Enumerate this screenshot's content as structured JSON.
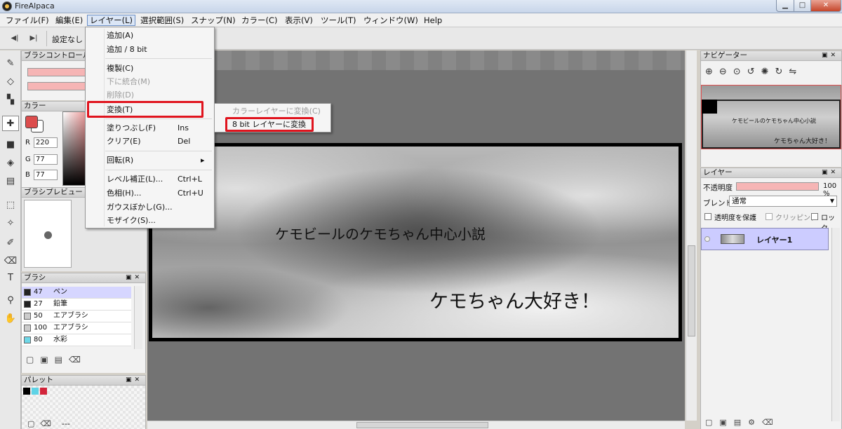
{
  "window": {
    "title": "FireAlpaca",
    "minimize": "▁",
    "maximize": "□",
    "close": "✕"
  },
  "menubar": [
    "ファイル(F)",
    "編集(E)",
    "レイヤー(L)",
    "選択範囲(S)",
    "スナップ(N)",
    "カラー(C)",
    "表示(V)",
    "ツール(T)",
    "ウィンドウ(W)",
    "Help"
  ],
  "toolbar": {
    "prev": "◀|",
    "next": "▶|",
    "preset_label": "設定なし"
  },
  "layer_menu": {
    "items": [
      {
        "label": "追加(A)",
        "shortcut": "",
        "disabled": false
      },
      {
        "label": "追加 / 8 bit",
        "shortcut": "",
        "disabled": false
      },
      {
        "label": "複製(C)",
        "shortcut": "",
        "disabled": false
      },
      {
        "label": "下に統合(M)",
        "shortcut": "",
        "disabled": true
      },
      {
        "label": "削除(D)",
        "shortcut": "",
        "disabled": true
      },
      {
        "label": "変換(T)",
        "shortcut": "",
        "disabled": false
      },
      {
        "label": "塗りつぶし(F)",
        "shortcut": "Ins",
        "disabled": false
      },
      {
        "label": "クリア(E)",
        "shortcut": "Del",
        "disabled": false
      },
      {
        "label": "回転(R)",
        "shortcut": "▸",
        "disabled": false
      },
      {
        "label": "レベル補正(L)...",
        "shortcut": "Ctrl+L",
        "disabled": false
      },
      {
        "label": "色相(H)...",
        "shortcut": "Ctrl+U",
        "disabled": false
      },
      {
        "label": "ガウスぼかし(G)...",
        "shortcut": "",
        "disabled": false
      },
      {
        "label": "モザイク(S)...",
        "shortcut": "",
        "disabled": false
      }
    ]
  },
  "convert_submenu": {
    "items": [
      {
        "label": "カラーレイヤーに変換(C)",
        "disabled": true
      },
      {
        "label": "8 bit レイヤーに変換",
        "disabled": false
      }
    ]
  },
  "panels": {
    "brush_control": {
      "title": "ブラシコントロール",
      "size_fraction": 0.55
    },
    "color": {
      "title": "カラー",
      "r_label": "R",
      "r": "220",
      "g_label": "G",
      "g": "77",
      "b_label": "B",
      "b": "77",
      "fg": "#dc4d4d",
      "bg": "#ffffff"
    },
    "brush_preview": {
      "title": "ブラシプレビュー"
    },
    "brush": {
      "title": "ブラシ",
      "items": [
        {
          "size": "47",
          "name": "ペン",
          "selected": true,
          "swatch": "#222222"
        },
        {
          "size": "27",
          "name": "鉛筆",
          "selected": false,
          "swatch": "#222222"
        },
        {
          "size": "50",
          "name": "エアブラシ",
          "selected": false,
          "swatch": "#cccccc"
        },
        {
          "size": "100",
          "name": "エアブラシ",
          "selected": false,
          "swatch": "#cccccc"
        },
        {
          "size": "80",
          "name": "水彩",
          "selected": false,
          "swatch": "#6fd8e8"
        }
      ]
    },
    "palette": {
      "title": "パレット",
      "footer": "---",
      "swatches": [
        "#000000",
        "#5fd3e6",
        "#d2243a"
      ]
    },
    "navigator": {
      "title": "ナビゲーター",
      "thumb_text1": "ケモビールのケモちゃん中心小説",
      "thumb_text2": "ケモちゃん大好き！"
    },
    "layer": {
      "title": "レイヤー",
      "opacity_label": "不透明度",
      "opacity_value": "100 %",
      "blend_label": "ブレンド",
      "blend_value": "通常",
      "protect_label": "透明度を保護",
      "clipping_label": "クリッピング",
      "lock_label": "ロック",
      "layer_name": "レイヤー1"
    }
  },
  "canvas": {
    "text1": "ケモビールのケモちゃん中心小説",
    "text2": "ケモちゃん大好き！"
  },
  "tool_icons": [
    "pen-icon",
    "eraser-icon",
    "dots-icon",
    "move-icon",
    "fill-rect-icon",
    "bucket-icon",
    "gradient-icon",
    "select-rect-icon",
    "magic-wand-icon",
    "select-pen-icon",
    "select-eraser-icon",
    "text-icon",
    "eyedropper-icon",
    "hand-icon"
  ],
  "colors": {
    "accent": "#e0141e",
    "layer_selected": "#ccccff",
    "brush_selected": "#d6d6ff"
  }
}
